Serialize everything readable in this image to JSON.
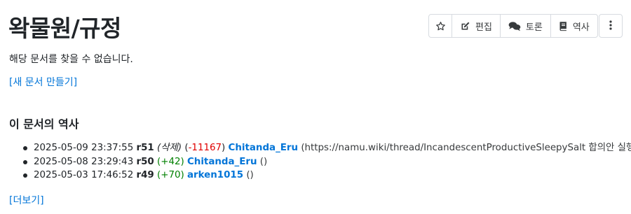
{
  "page": {
    "title": "왁물원/규정"
  },
  "toolbar": {
    "star_icon": "star-outline-icon",
    "edit_label": "편집",
    "edit_icon": "pencil-square-icon",
    "discuss_label": "토론",
    "discuss_icon": "comments-icon",
    "history_label": "역사",
    "history_icon": "book-icon",
    "more_icon": "vertical-ellipsis-icon"
  },
  "main": {
    "notice": "해당 문서를 찾을 수 없습니다.",
    "create_link": "[새 문서 만들기]",
    "history_heading": "이 문서의 역사",
    "history": [
      {
        "datetime": "2025-05-09 23:37:55",
        "rev": "r51",
        "action": "(삭제)",
        "diff_open": "(",
        "diff": "-11167",
        "diff_close": ")",
        "user": "Chitanda_Eru",
        "comment": "(https://namu.wiki/thread/IncandescentProductiveSleepySalt 합의안 실행.)"
      },
      {
        "datetime": "2025-05-08 23:29:43",
        "rev": "r50",
        "diff": "(+42)",
        "user": "Chitanda_Eru",
        "comment": "()"
      },
      {
        "datetime": "2025-05-03 17:46:52",
        "rev": "r49",
        "diff": "(+70)",
        "user": "arken1015",
        "comment": "()"
      }
    ],
    "more_link": "[더보기]"
  },
  "colors": {
    "link": "#0275d8",
    "negative": "#e00000",
    "positive": "#008000",
    "text": "#212529"
  }
}
